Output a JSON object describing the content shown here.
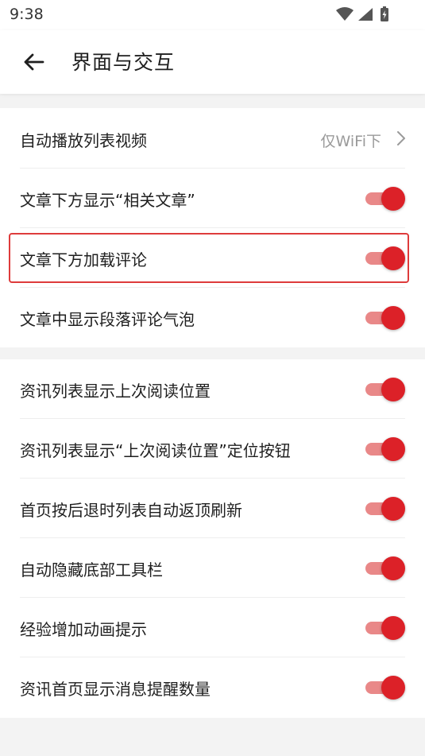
{
  "status_bar": {
    "time": "9:38"
  },
  "header": {
    "title": "界面与交互"
  },
  "sections": [
    {
      "items": [
        {
          "label": "自动播放列表视频",
          "type": "select",
          "value": "仅WiFi下"
        },
        {
          "label": "文章下方显示“相关文章”",
          "type": "toggle",
          "on": true
        },
        {
          "label": "文章下方加载评论",
          "type": "toggle",
          "on": true,
          "highlighted": true
        },
        {
          "label": "文章中显示段落评论气泡",
          "type": "toggle",
          "on": true
        }
      ]
    },
    {
      "items": [
        {
          "label": "资讯列表显示上次阅读位置",
          "type": "toggle",
          "on": true
        },
        {
          "label": "资讯列表显示“上次阅读位置”定位按钮",
          "type": "toggle",
          "on": true
        },
        {
          "label": "首页按后退时列表自动返顶刷新",
          "type": "toggle",
          "on": true
        },
        {
          "label": "自动隐藏底部工具栏",
          "type": "toggle",
          "on": true
        },
        {
          "label": "经验增加动画提示",
          "type": "toggle",
          "on": true
        },
        {
          "label": "资讯首页显示消息提醒数量",
          "type": "toggle",
          "on": true
        }
      ]
    }
  ],
  "colors": {
    "accent": "#dc2128",
    "track_on": "#e98888",
    "highlight_border": "#de3b3b",
    "background": "#f3f3f3"
  },
  "icons": {
    "back": "arrow-left-icon",
    "chevron": "chevron-right-icon",
    "wifi": "wifi-icon",
    "signal": "signal-icon",
    "battery": "battery-icon"
  }
}
